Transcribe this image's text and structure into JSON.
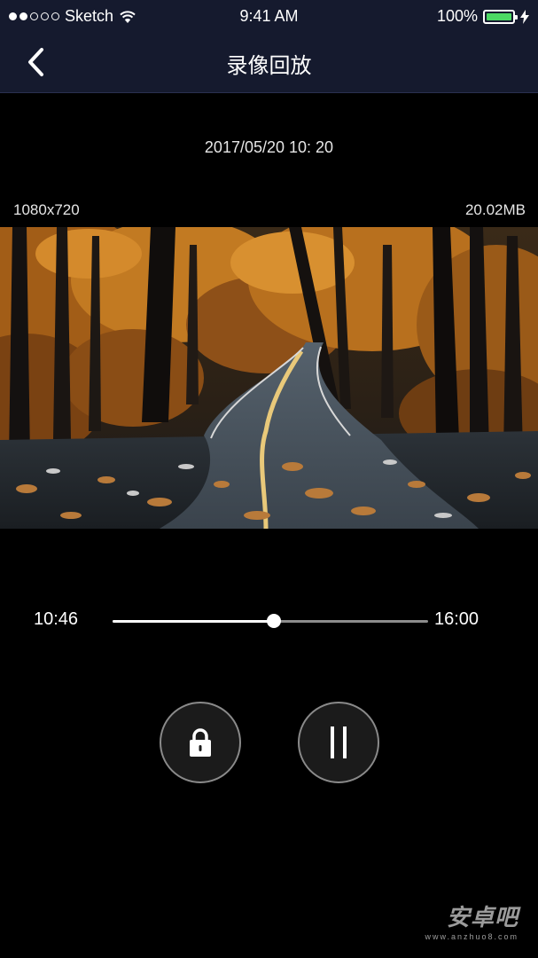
{
  "status_bar": {
    "carrier": "Sketch",
    "time": "9:41 AM",
    "battery": "100%",
    "signal_dots": [
      true,
      true,
      false,
      false,
      false
    ],
    "icons": [
      "wifi-icon",
      "battery-icon",
      "charging-bolt-icon"
    ],
    "battery_color": "#4cd964"
  },
  "nav": {
    "title": "录像回放",
    "back_icon": "chevron-left-icon",
    "background": "#151a2e"
  },
  "recording": {
    "timestamp": "2017/05/20 10: 20",
    "resolution": "1080x720",
    "file_size": "20.02MB"
  },
  "video": {
    "scene": "autumn forest road"
  },
  "playback": {
    "current_time": "10:46",
    "total_time": "16:00",
    "progress": 0.51
  },
  "controls": {
    "lock_icon": "lock-icon",
    "pause_icon": "pause-icon"
  },
  "watermark": {
    "text": "安卓吧",
    "url": "www.anzhuo8.com"
  }
}
